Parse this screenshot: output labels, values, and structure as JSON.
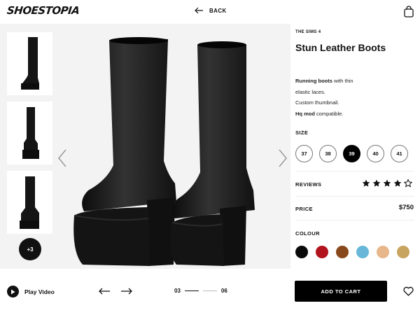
{
  "header": {
    "logo": "SHOESTOPIA",
    "back_label": "BACK"
  },
  "gallery": {
    "more_label": "+3"
  },
  "product": {
    "breadcrumb": "THE SIMS 4",
    "title": "Stun Leather Boots",
    "desc_line1_bold": "Running boots",
    "desc_line1_rest": " with thin",
    "desc_line2": "elastic laces.",
    "desc_line3": "Custom thumbnail.",
    "desc_line4_bold": "Hq mod",
    "desc_line4_rest": " compatible.",
    "size_label": "SIZE",
    "sizes": [
      "37",
      "38",
      "39",
      "40",
      "41"
    ],
    "selected_size": "39",
    "reviews_label": "REVIEWS",
    "rating": 4,
    "rating_max": 5,
    "price_label": "PRICE",
    "price": "$750",
    "colour_label": "COLOUR",
    "colours": [
      "#0a0a0a",
      "#b1141c",
      "#87481c",
      "#69b7d8",
      "#e8b68b",
      "#c7a45f"
    ]
  },
  "footer": {
    "play_label": "Play Video",
    "page_current": "03",
    "page_total": "06",
    "cart_label": "ADD TO CART"
  }
}
